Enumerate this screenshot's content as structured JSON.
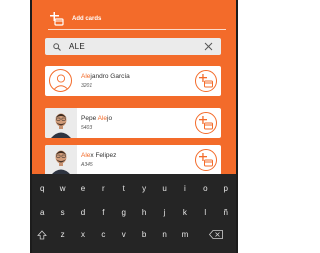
{
  "header": {
    "title": "Add cards",
    "icon": "add-card-icon"
  },
  "search": {
    "value": "ALE",
    "icon": "search-icon",
    "clear_icon": "close-icon"
  },
  "results": [
    {
      "name_highlight": "Ale",
      "name_rest": "jandro García",
      "code": "3201",
      "avatar": "person-outline-icon",
      "action_icon": "add-card-icon"
    },
    {
      "name_prefix": "Pepe ",
      "name_highlight": "Ale",
      "name_rest": "jo",
      "code": "5403",
      "avatar": "user-photo",
      "action_icon": "add-card-icon"
    },
    {
      "name_highlight": "Ale",
      "name_rest": "x Felipez",
      "code": "A345",
      "avatar": "user-photo",
      "action_icon": "add-card-icon"
    }
  ],
  "keyboard": {
    "row1": [
      "q",
      "w",
      "e",
      "r",
      "t",
      "y",
      "u",
      "i",
      "o",
      "p"
    ],
    "row2": [
      "a",
      "s",
      "d",
      "f",
      "g",
      "h",
      "j",
      "k",
      "l",
      "ñ"
    ],
    "row3": [
      "z",
      "x",
      "c",
      "v",
      "b",
      "n",
      "m"
    ],
    "shift_icon": "shift-icon",
    "backspace_icon": "backspace-icon"
  },
  "colors": {
    "accent": "#f36b2a",
    "keyboard_bg": "#252525",
    "search_bg": "#ebebeb"
  }
}
